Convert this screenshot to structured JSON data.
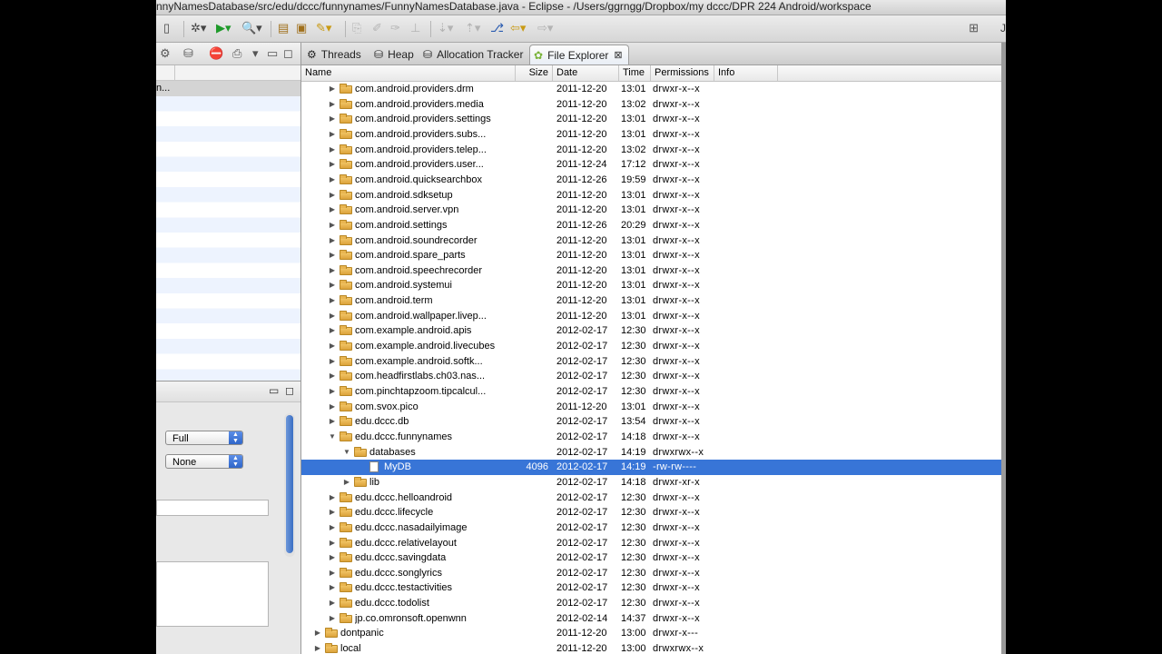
{
  "window": {
    "title": "nnyNamesDatabase/src/edu/dccc/funnynames/FunnyNamesDatabase.java - Eclipse - /Users/ggrngg/Dropbox/my dccc/DPR 224 Android/workspace",
    "toolbar_right_text": "J"
  },
  "left_panel": {
    "selected_row_text": "n..."
  },
  "left_lower_panel": {
    "combo1_value": "Full",
    "combo2_value": "None"
  },
  "tabs": [
    {
      "label": "Threads",
      "icon": "threads-icon",
      "active": false
    },
    {
      "label": "Heap",
      "icon": "heap-icon",
      "active": false
    },
    {
      "label": "Allocation Tracker",
      "icon": "allocation-tracker-icon",
      "active": false
    },
    {
      "label": "File Explorer",
      "icon": "android-icon",
      "active": true
    }
  ],
  "columns": {
    "name": "Name",
    "size": "Size",
    "date": "Date",
    "time": "Time",
    "permissions": "Permissions",
    "info": "Info"
  },
  "rows": [
    {
      "name": "com.android.providers.drm",
      "size": "",
      "date": "2011-12-20",
      "time": "13:01",
      "perm": "drwxr-x--x",
      "level": 2,
      "type": "folder",
      "expanded": false
    },
    {
      "name": "com.android.providers.media",
      "size": "",
      "date": "2011-12-20",
      "time": "13:02",
      "perm": "drwxr-x--x",
      "level": 2,
      "type": "folder",
      "expanded": false
    },
    {
      "name": "com.android.providers.settings",
      "size": "",
      "date": "2011-12-20",
      "time": "13:01",
      "perm": "drwxr-x--x",
      "level": 2,
      "type": "folder",
      "expanded": false
    },
    {
      "name": "com.android.providers.subs...",
      "size": "",
      "date": "2011-12-20",
      "time": "13:01",
      "perm": "drwxr-x--x",
      "level": 2,
      "type": "folder",
      "expanded": false
    },
    {
      "name": "com.android.providers.telep...",
      "size": "",
      "date": "2011-12-20",
      "time": "13:02",
      "perm": "drwxr-x--x",
      "level": 2,
      "type": "folder",
      "expanded": false
    },
    {
      "name": "com.android.providers.user...",
      "size": "",
      "date": "2011-12-24",
      "time": "17:12",
      "perm": "drwxr-x--x",
      "level": 2,
      "type": "folder",
      "expanded": false
    },
    {
      "name": "com.android.quicksearchbox",
      "size": "",
      "date": "2011-12-26",
      "time": "19:59",
      "perm": "drwxr-x--x",
      "level": 2,
      "type": "folder",
      "expanded": false
    },
    {
      "name": "com.android.sdksetup",
      "size": "",
      "date": "2011-12-20",
      "time": "13:01",
      "perm": "drwxr-x--x",
      "level": 2,
      "type": "folder",
      "expanded": false
    },
    {
      "name": "com.android.server.vpn",
      "size": "",
      "date": "2011-12-20",
      "time": "13:01",
      "perm": "drwxr-x--x",
      "level": 2,
      "type": "folder",
      "expanded": false
    },
    {
      "name": "com.android.settings",
      "size": "",
      "date": "2011-12-26",
      "time": "20:29",
      "perm": "drwxr-x--x",
      "level": 2,
      "type": "folder",
      "expanded": false
    },
    {
      "name": "com.android.soundrecorder",
      "size": "",
      "date": "2011-12-20",
      "time": "13:01",
      "perm": "drwxr-x--x",
      "level": 2,
      "type": "folder",
      "expanded": false
    },
    {
      "name": "com.android.spare_parts",
      "size": "",
      "date": "2011-12-20",
      "time": "13:01",
      "perm": "drwxr-x--x",
      "level": 2,
      "type": "folder",
      "expanded": false
    },
    {
      "name": "com.android.speechrecorder",
      "size": "",
      "date": "2011-12-20",
      "time": "13:01",
      "perm": "drwxr-x--x",
      "level": 2,
      "type": "folder",
      "expanded": false
    },
    {
      "name": "com.android.systemui",
      "size": "",
      "date": "2011-12-20",
      "time": "13:01",
      "perm": "drwxr-x--x",
      "level": 2,
      "type": "folder",
      "expanded": false
    },
    {
      "name": "com.android.term",
      "size": "",
      "date": "2011-12-20",
      "time": "13:01",
      "perm": "drwxr-x--x",
      "level": 2,
      "type": "folder",
      "expanded": false
    },
    {
      "name": "com.android.wallpaper.livep...",
      "size": "",
      "date": "2011-12-20",
      "time": "13:01",
      "perm": "drwxr-x--x",
      "level": 2,
      "type": "folder",
      "expanded": false
    },
    {
      "name": "com.example.android.apis",
      "size": "",
      "date": "2012-02-17",
      "time": "12:30",
      "perm": "drwxr-x--x",
      "level": 2,
      "type": "folder",
      "expanded": false
    },
    {
      "name": "com.example.android.livecubes",
      "size": "",
      "date": "2012-02-17",
      "time": "12:30",
      "perm": "drwxr-x--x",
      "level": 2,
      "type": "folder",
      "expanded": false
    },
    {
      "name": "com.example.android.softk...",
      "size": "",
      "date": "2012-02-17",
      "time": "12:30",
      "perm": "drwxr-x--x",
      "level": 2,
      "type": "folder",
      "expanded": false
    },
    {
      "name": "com.headfirstlabs.ch03.nas...",
      "size": "",
      "date": "2012-02-17",
      "time": "12:30",
      "perm": "drwxr-x--x",
      "level": 2,
      "type": "folder",
      "expanded": false
    },
    {
      "name": "com.pinchtapzoom.tipcalcul...",
      "size": "",
      "date": "2012-02-17",
      "time": "12:30",
      "perm": "drwxr-x--x",
      "level": 2,
      "type": "folder",
      "expanded": false
    },
    {
      "name": "com.svox.pico",
      "size": "",
      "date": "2011-12-20",
      "time": "13:01",
      "perm": "drwxr-x--x",
      "level": 2,
      "type": "folder",
      "expanded": false
    },
    {
      "name": "edu.dccc.db",
      "size": "",
      "date": "2012-02-17",
      "time": "13:54",
      "perm": "drwxr-x--x",
      "level": 2,
      "type": "folder",
      "expanded": false
    },
    {
      "name": "edu.dccc.funnynames",
      "size": "",
      "date": "2012-02-17",
      "time": "14:18",
      "perm": "drwxr-x--x",
      "level": 2,
      "type": "folder",
      "expanded": true
    },
    {
      "name": "databases",
      "size": "",
      "date": "2012-02-17",
      "time": "14:19",
      "perm": "drwxrwx--x",
      "level": 3,
      "type": "folder",
      "expanded": true
    },
    {
      "name": "MyDB",
      "size": "4096",
      "date": "2012-02-17",
      "time": "14:19",
      "perm": "-rw-rw----",
      "level": 4,
      "type": "file",
      "selected": true
    },
    {
      "name": "lib",
      "size": "",
      "date": "2012-02-17",
      "time": "14:18",
      "perm": "drwxr-xr-x",
      "level": 3,
      "type": "folder",
      "expanded": false
    },
    {
      "name": "edu.dccc.helloandroid",
      "size": "",
      "date": "2012-02-17",
      "time": "12:30",
      "perm": "drwxr-x--x",
      "level": 2,
      "type": "folder",
      "expanded": false
    },
    {
      "name": "edu.dccc.lifecycle",
      "size": "",
      "date": "2012-02-17",
      "time": "12:30",
      "perm": "drwxr-x--x",
      "level": 2,
      "type": "folder",
      "expanded": false
    },
    {
      "name": "edu.dccc.nasadailyimage",
      "size": "",
      "date": "2012-02-17",
      "time": "12:30",
      "perm": "drwxr-x--x",
      "level": 2,
      "type": "folder",
      "expanded": false
    },
    {
      "name": "edu.dccc.relativelayout",
      "size": "",
      "date": "2012-02-17",
      "time": "12:30",
      "perm": "drwxr-x--x",
      "level": 2,
      "type": "folder",
      "expanded": false
    },
    {
      "name": "edu.dccc.savingdata",
      "size": "",
      "date": "2012-02-17",
      "time": "12:30",
      "perm": "drwxr-x--x",
      "level": 2,
      "type": "folder",
      "expanded": false
    },
    {
      "name": "edu.dccc.songlyrics",
      "size": "",
      "date": "2012-02-17",
      "time": "12:30",
      "perm": "drwxr-x--x",
      "level": 2,
      "type": "folder",
      "expanded": false
    },
    {
      "name": "edu.dccc.testactivities",
      "size": "",
      "date": "2012-02-17",
      "time": "12:30",
      "perm": "drwxr-x--x",
      "level": 2,
      "type": "folder",
      "expanded": false
    },
    {
      "name": "edu.dccc.todolist",
      "size": "",
      "date": "2012-02-17",
      "time": "12:30",
      "perm": "drwxr-x--x",
      "level": 2,
      "type": "folder",
      "expanded": false
    },
    {
      "name": "jp.co.omronsoft.openwnn",
      "size": "",
      "date": "2012-02-14",
      "time": "14:37",
      "perm": "drwxr-x--x",
      "level": 2,
      "type": "folder",
      "expanded": false
    },
    {
      "name": "dontpanic",
      "size": "",
      "date": "2011-12-20",
      "time": "13:00",
      "perm": "drwxr-x---",
      "level": 1,
      "type": "folder",
      "expanded": false
    },
    {
      "name": "local",
      "size": "",
      "date": "2011-12-20",
      "time": "13:00",
      "perm": "drwxrwx--x",
      "level": 1,
      "type": "folder",
      "expanded": false
    }
  ]
}
